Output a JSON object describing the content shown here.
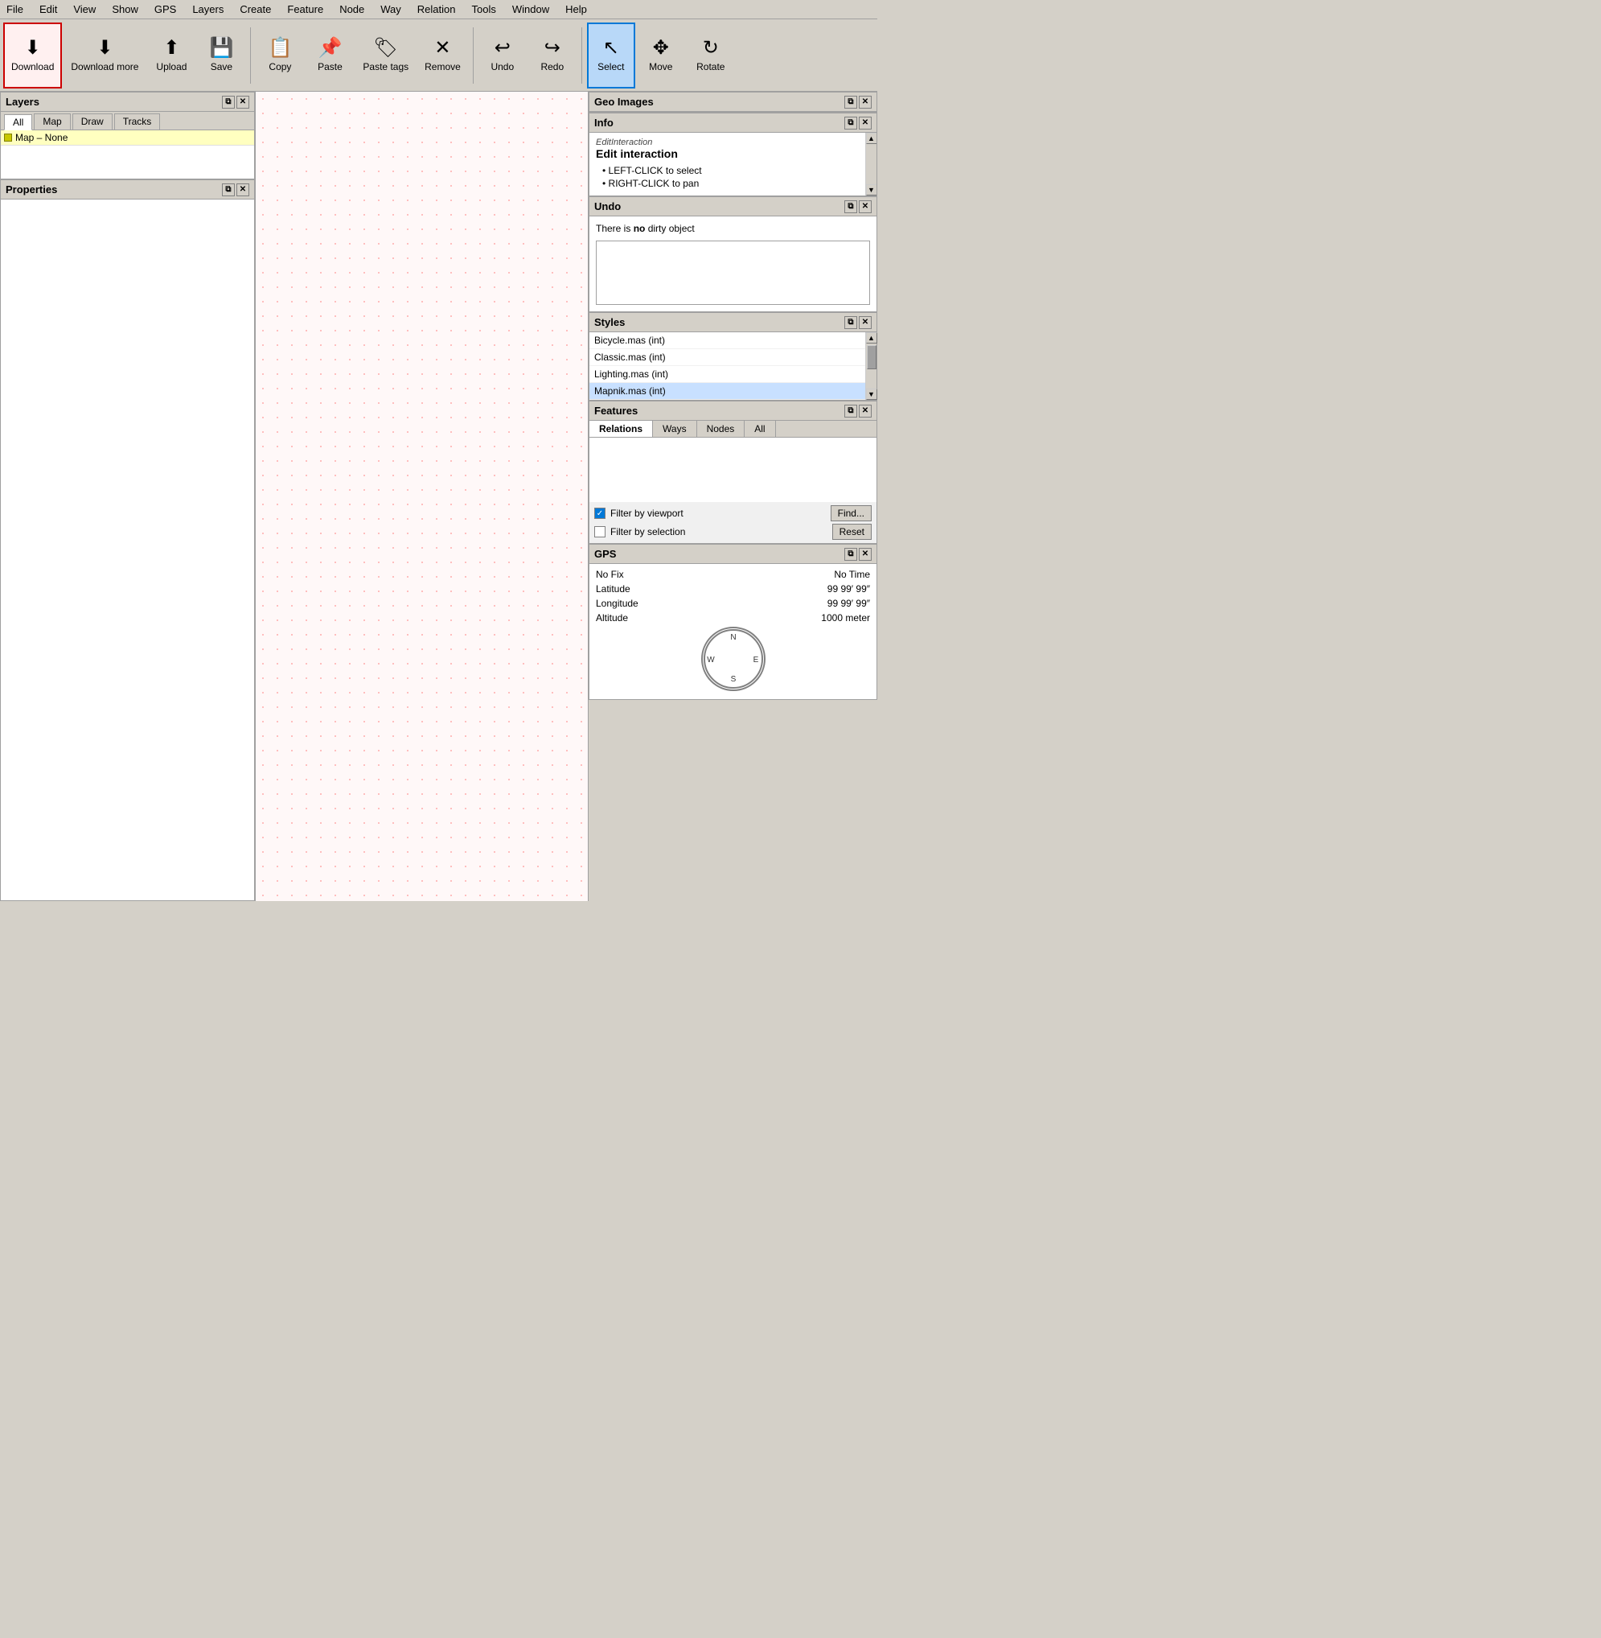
{
  "menubar": {
    "items": [
      "File",
      "Edit",
      "View",
      "Show",
      "GPS",
      "Layers",
      "Create",
      "Feature",
      "Node",
      "Way",
      "Relation",
      "Tools",
      "Window",
      "Help"
    ]
  },
  "toolbar": {
    "buttons": [
      {
        "id": "download",
        "label": "Download",
        "icon": "⬇",
        "highlighted": true
      },
      {
        "id": "download-more",
        "label": "Download more",
        "icon": "⬇"
      },
      {
        "id": "upload",
        "label": "Upload",
        "icon": "⬆"
      },
      {
        "id": "save",
        "label": "Save",
        "icon": "💾"
      },
      {
        "id": "copy",
        "label": "Copy",
        "icon": "📋"
      },
      {
        "id": "paste",
        "label": "Paste",
        "icon": "📌"
      },
      {
        "id": "paste-tags",
        "label": "Paste tags",
        "icon": "🏷"
      },
      {
        "id": "remove",
        "label": "Remove",
        "icon": "✕"
      },
      {
        "id": "undo",
        "label": "Undo",
        "icon": "↩"
      },
      {
        "id": "redo",
        "label": "Redo",
        "icon": "↪"
      },
      {
        "id": "select",
        "label": "Select",
        "icon": "↖",
        "active": true
      },
      {
        "id": "move",
        "label": "Move",
        "icon": "✥"
      },
      {
        "id": "rotate",
        "label": "Rotate",
        "icon": "↻"
      }
    ]
  },
  "layers": {
    "panel_title": "Layers",
    "tabs": [
      "All",
      "Map",
      "Draw",
      "Tracks"
    ],
    "active_tab": "All",
    "items": [
      {
        "label": "Map – None",
        "color": "#c8c800"
      }
    ]
  },
  "properties": {
    "panel_title": "Properties"
  },
  "geo_images": {
    "panel_title": "Geo Images"
  },
  "info": {
    "panel_title": "Info",
    "subtitle": "EditInteraction",
    "title": "Edit interaction",
    "bullets": [
      "LEFT-CLICK to select",
      "RIGHT-CLICK to pan"
    ]
  },
  "undo": {
    "panel_title": "Undo",
    "message_prefix": "There is ",
    "message_bold": "no",
    "message_suffix": " dirty object"
  },
  "styles": {
    "panel_title": "Styles",
    "items": [
      "Bicycle.mas (int)",
      "Classic.mas (int)",
      "Lighting.mas (int)",
      "Mapnik.mas (int)"
    ],
    "selected_index": 3
  },
  "features": {
    "panel_title": "Features",
    "tabs": [
      "Relations",
      "Ways",
      "Nodes",
      "All"
    ],
    "active_tab": "Relations",
    "filter_viewport": {
      "label": "Filter by viewport",
      "checked": true
    },
    "filter_selection": {
      "label": "Filter by selection",
      "checked": false
    },
    "find_label": "Find...",
    "reset_label": "Reset"
  },
  "gps": {
    "panel_title": "GPS",
    "fix_label": "No Fix",
    "time_label": "No Time",
    "latitude_label": "Latitude",
    "latitude_value": "99 99′ 99″",
    "longitude_label": "Longitude",
    "longitude_value": "99 99′ 99″",
    "altitude_label": "Altitude",
    "altitude_value": "1000 meter"
  }
}
